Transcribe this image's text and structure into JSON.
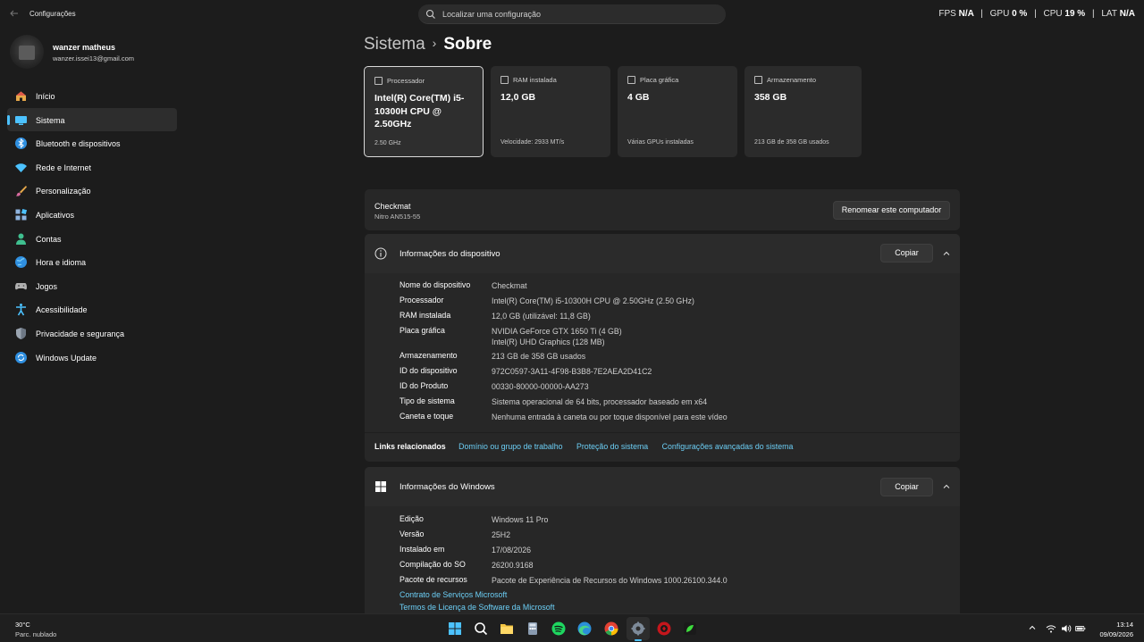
{
  "window": {
    "title": "Configurações"
  },
  "search": {
    "placeholder": "Localizar uma configuração"
  },
  "overlay": {
    "fps_label": "FPS",
    "fps_value": "N/A",
    "gpu_label": "GPU",
    "gpu_value": "0 %",
    "cpu_label": "CPU",
    "cpu_value": "19 %",
    "lat_label": "LAT",
    "lat_value": "N/A",
    "separator": "|"
  },
  "profile": {
    "name": "wanzer matheus",
    "email": "wanzer.issei13@gmail.com"
  },
  "sidebar": {
    "items": [
      {
        "label": "Início",
        "icon": "home-icon"
      },
      {
        "label": "Sistema",
        "icon": "system-icon",
        "active": true
      },
      {
        "label": "Bluetooth e dispositivos",
        "icon": "bluetooth-icon"
      },
      {
        "label": "Rede e Internet",
        "icon": "wifi-icon"
      },
      {
        "label": "Personalização",
        "icon": "brush-icon"
      },
      {
        "label": "Aplicativos",
        "icon": "apps-icon"
      },
      {
        "label": "Contas",
        "icon": "account-icon"
      },
      {
        "label": "Hora e idioma",
        "icon": "globe-icon"
      },
      {
        "label": "Jogos",
        "icon": "gamepad-icon"
      },
      {
        "label": "Acessibilidade",
        "icon": "accessibility-icon"
      },
      {
        "label": "Privacidade e segurança",
        "icon": "shield-icon"
      },
      {
        "label": "Windows Update",
        "icon": "update-icon"
      }
    ]
  },
  "breadcrumb": {
    "parent": "Sistema",
    "separator": "›",
    "current": "Sobre"
  },
  "specs": [
    {
      "title": "Processador",
      "value": "Intel(R) Core(TM) i5-10300H CPU @ 2.50GHz",
      "foot": "2.50 GHz"
    },
    {
      "title": "RAM instalada",
      "value": "12,0 GB",
      "foot": "Velocidade: 2933 MT/s"
    },
    {
      "title": "Placa gráfica",
      "value": "4 GB",
      "foot": "Várias GPUs instaladas"
    },
    {
      "title": "Armazenamento",
      "value": "358 GB",
      "foot": "213 GB de 358 GB usados"
    }
  ],
  "computer": {
    "name": "Checkmat",
    "model": "Nitro AN515-55",
    "rename_button": "Renomear este computador"
  },
  "device_info": {
    "title": "Informações do dispositivo",
    "copy_button": "Copiar",
    "rows": [
      {
        "key": "Nome do dispositivo",
        "value": "Checkmat"
      },
      {
        "key": "Processador",
        "value": "Intel(R) Core(TM) i5-10300H CPU @ 2.50GHz (2.50 GHz)"
      },
      {
        "key": "RAM instalada",
        "value": "12,0 GB (utilizável: 11,8 GB)"
      },
      {
        "key": "Placa gráfica",
        "value": "NVIDIA GeForce GTX 1650 Ti (4 GB)",
        "value2": "Intel(R) UHD Graphics (128 MB)"
      },
      {
        "key": "Armazenamento",
        "value": "213 GB de 358 GB usados"
      },
      {
        "key": "ID do dispositivo",
        "value": "972C0597-3A11-4F98-B3B8-7E2AEA2D41C2"
      },
      {
        "key": "ID do Produto",
        "value": "00330-80000-00000-AA273"
      },
      {
        "key": "Tipo de sistema",
        "value": "Sistema operacional de 64 bits, processador baseado em x64"
      },
      {
        "key": "Caneta e toque",
        "value": "Nenhuma entrada à caneta ou por toque disponível para este vídeo"
      }
    ]
  },
  "related_links": {
    "label": "Links relacionados",
    "links": [
      "Domínio ou grupo de trabalho",
      "Proteção do sistema",
      "Configurações avançadas do sistema"
    ]
  },
  "windows_info": {
    "title": "Informações do Windows",
    "copy_button": "Copiar",
    "rows": [
      {
        "key": "Edição",
        "value": "Windows 11 Pro"
      },
      {
        "key": "Versão",
        "value": "25H2"
      },
      {
        "key": "Instalado em",
        "value": "17/08/2026"
      },
      {
        "key": "Compilação do SO",
        "value": "26200.9168"
      },
      {
        "key": "Pacote de recursos",
        "value": "Pacote de Experiência de Recursos do Windows 1000.26100.344.0"
      }
    ],
    "links": [
      "Contrato de Serviços Microsoft",
      "Termos de Licença de Software da Microsoft"
    ]
  },
  "taskbar": {
    "weather_temp": "30°C",
    "weather_desc": "Parc. nublado",
    "time": "13:14",
    "date": "09/09/2026",
    "apps": [
      "start-icon",
      "search-icon",
      "file-explorer-icon",
      "calculator-icon",
      "spotify-icon",
      "edge-icon",
      "chrome-icon",
      "settings-icon",
      "red-app-icon",
      "green-app-icon"
    ]
  },
  "colors": {
    "accent": "#4cc2ff",
    "link": "#6ccff6",
    "background": "#1c1c1c",
    "card": "#2b2b2b"
  }
}
